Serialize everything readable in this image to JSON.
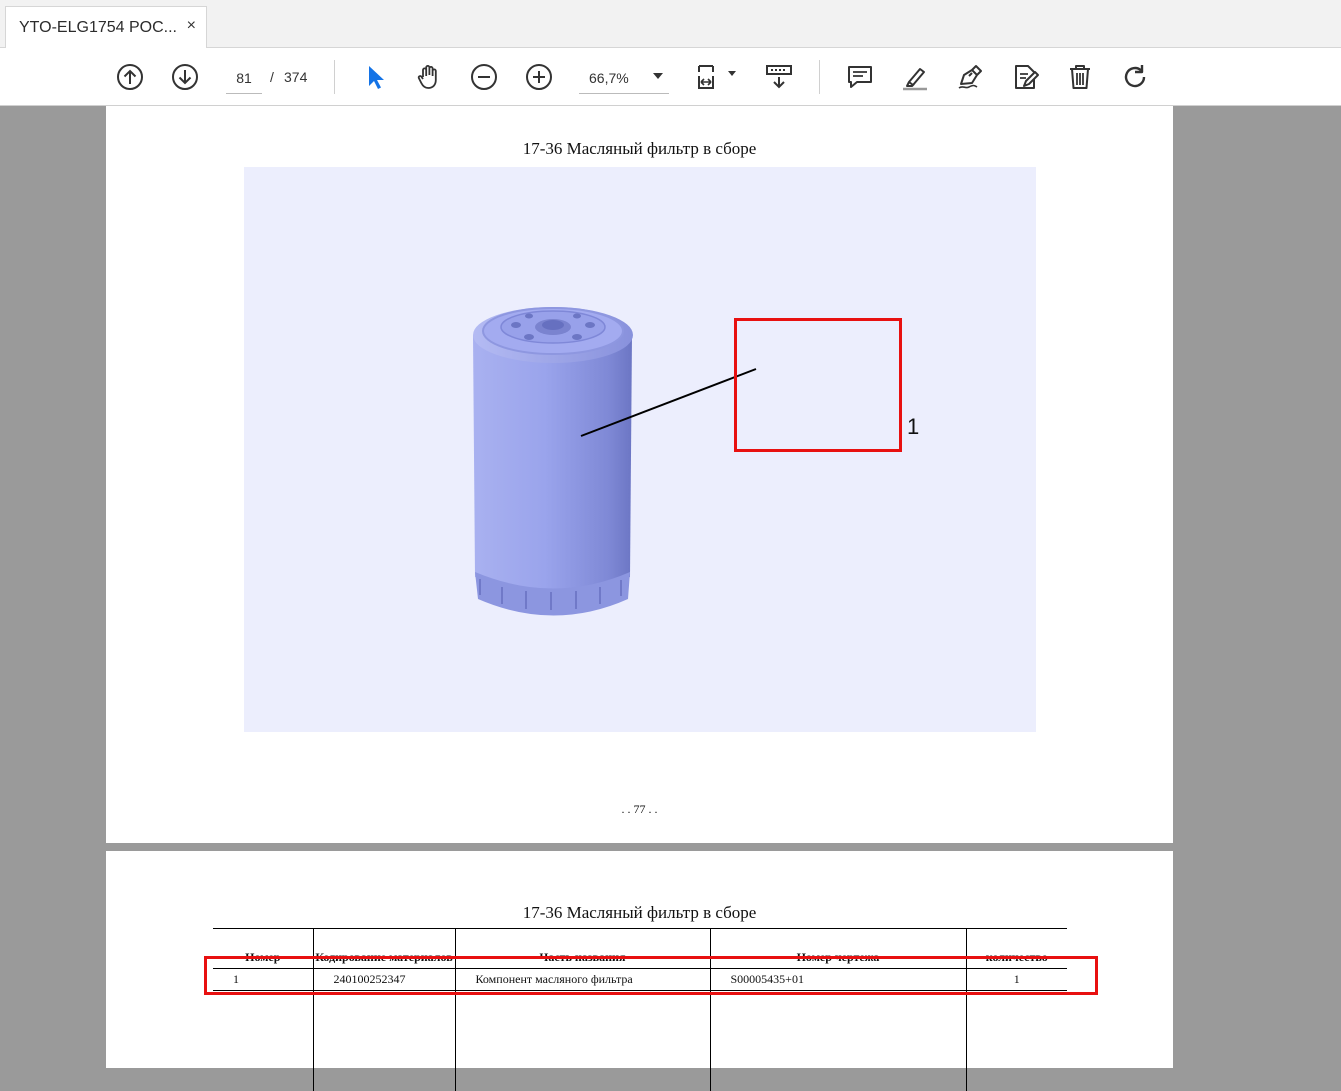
{
  "tab": {
    "title": "YTO-ELG1754 POC...",
    "close": "×"
  },
  "toolbar": {
    "page_current": "81",
    "page_sep": "/",
    "page_total": "374",
    "zoom": "66,7%"
  },
  "page1": {
    "title": "17-36 Масляный фильтр в сборе",
    "callout": "1",
    "page_number": ". . 77 . ."
  },
  "page2": {
    "title": "17-36 Масляный фильтр в сборе",
    "table": {
      "headers": [
        "Номер",
        "Кодирование материалов",
        "Часть названия",
        "Номер чертежа",
        "количество"
      ],
      "rows": [
        [
          "1",
          "240100252347",
          "Компонент масляного фильтра",
          "S00005435+01",
          "1"
        ]
      ]
    }
  },
  "colors": {
    "highlight": "#e81010",
    "figure_bg": "#eceefd",
    "part_fill": "#9aa4ec",
    "icon_blue": "#1473e6"
  }
}
